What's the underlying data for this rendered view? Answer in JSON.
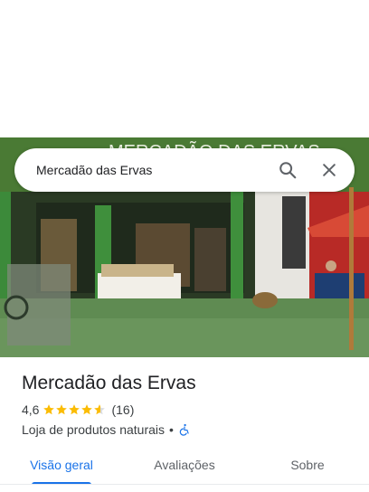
{
  "search": {
    "query": "Mercadão das Ervas",
    "search_icon": "search-icon",
    "close_icon": "close-icon"
  },
  "photo": {
    "sign_text": "MERCADÃO DAS ERVAS",
    "colors": {
      "wall": "#3d6b2c",
      "floor": "#5c8a4e",
      "awning": "#c8332b"
    }
  },
  "place": {
    "name": "Mercadão das Ervas",
    "rating": "4,6",
    "rating_value": 4.6,
    "stars_total": 5,
    "review_count": "(16)",
    "category": "Loja de produtos naturais",
    "separator": "•",
    "accessibility_icon": "wheelchair-accessible-icon",
    "star_color": "#fbbc04",
    "accessibility_color": "#1a73e8"
  },
  "tabs": [
    {
      "label": "Visão geral",
      "active": true
    },
    {
      "label": "Avaliações",
      "active": false
    },
    {
      "label": "Sobre",
      "active": false
    }
  ],
  "accent_color": "#1a73e8"
}
